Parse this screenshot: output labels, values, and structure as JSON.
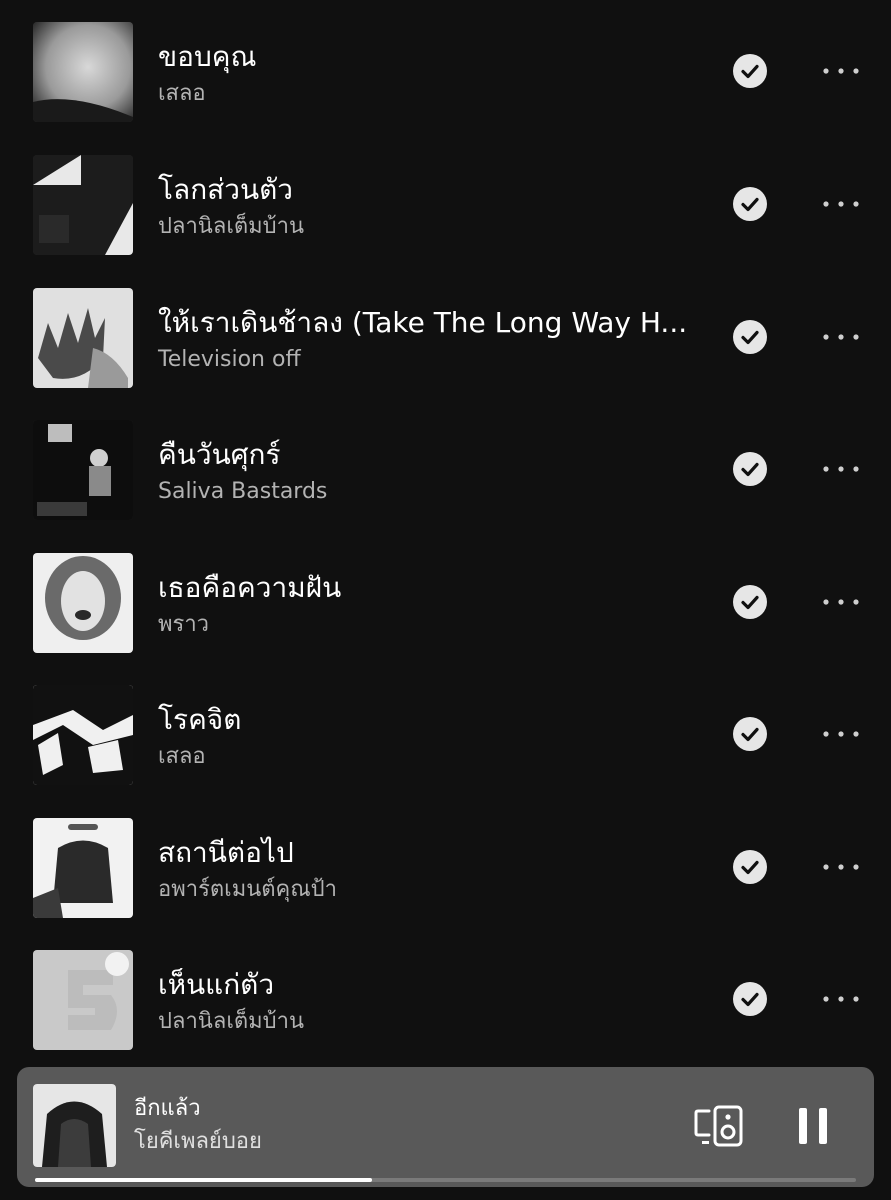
{
  "tracks": [
    {
      "title": "ขอบคุณ",
      "artist": "เสลอ"
    },
    {
      "title": "โลกส่วนตัว",
      "artist": "ปลานิลเต็มบ้าน"
    },
    {
      "title": "ให้เราเดินช้าลง (Take The Long Way H...",
      "artist": "Television off"
    },
    {
      "title": "คืนวันศุกร์",
      "artist": "Saliva Bastards"
    },
    {
      "title": "เธอคือความฝัน",
      "artist": "พราว"
    },
    {
      "title": "โรคจิต",
      "artist": "เสลอ"
    },
    {
      "title": "สถานีต่อไป",
      "artist": "อพาร์ตเมนต์คุณป้า"
    },
    {
      "title": "เห็นแก่ตัว",
      "artist": "ปลานิลเต็มบ้าน"
    }
  ],
  "now_playing": {
    "title": "อีกแล้ว",
    "artist": "โยคีเพลย์บอย",
    "progress": 0.41
  },
  "icons": {
    "downloaded": "check-circle-icon",
    "more": "more-horizontal-icon",
    "device": "speaker-device-icon",
    "pause": "pause-icon"
  },
  "colors": {
    "background": "#101010",
    "mini_player": "#595959",
    "secondary_text": "#b3b3b3"
  }
}
